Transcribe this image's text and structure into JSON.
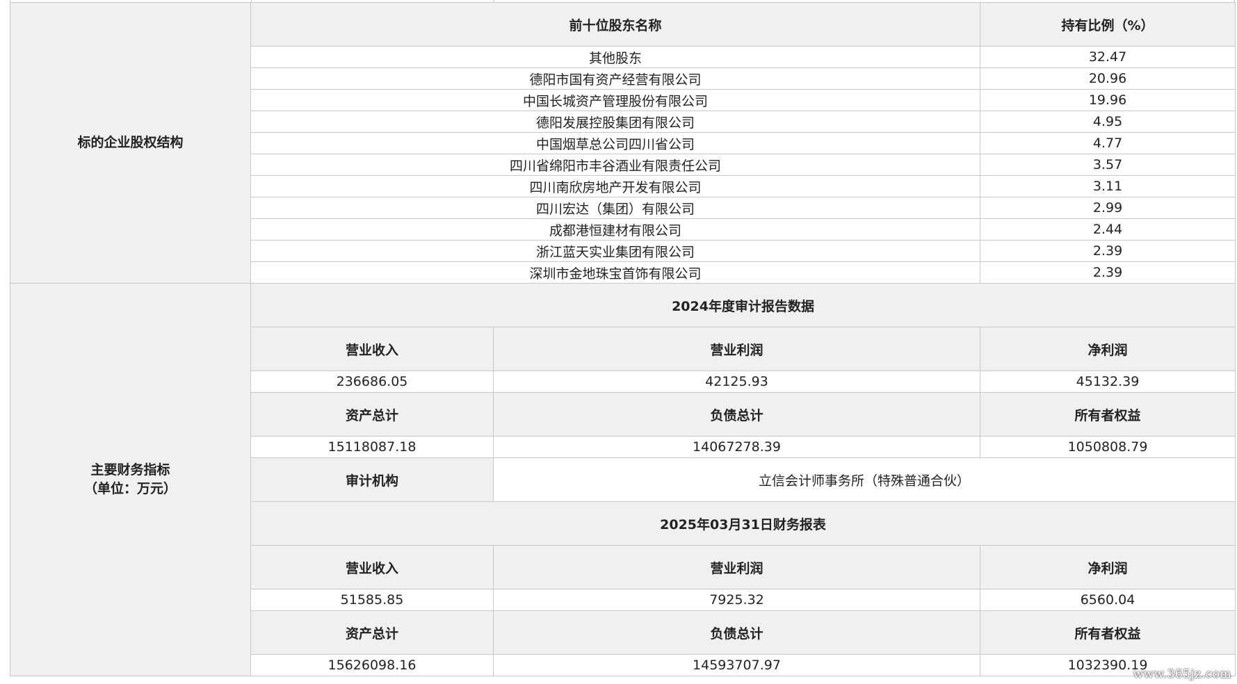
{
  "equity": {
    "section_label": "标的企业股权结构",
    "col_name_header": "前十位股东名称",
    "col_ratio_header": "持有比例（%）",
    "rows": [
      {
        "name": "其他股东",
        "ratio": "32.47"
      },
      {
        "name": "德阳市国有资产经营有限公司",
        "ratio": "20.96"
      },
      {
        "name": "中国长城资产管理股份有限公司",
        "ratio": "19.96"
      },
      {
        "name": "德阳发展控股集团有限公司",
        "ratio": "4.95"
      },
      {
        "name": "中国烟草总公司四川省公司",
        "ratio": "4.77"
      },
      {
        "name": "四川省绵阳市丰谷酒业有限责任公司",
        "ratio": "3.57"
      },
      {
        "name": "四川南欣房地产开发有限公司",
        "ratio": "3.11"
      },
      {
        "name": "四川宏达（集团）有限公司",
        "ratio": "2.99"
      },
      {
        "name": "成都港恒建材有限公司",
        "ratio": "2.44"
      },
      {
        "name": "浙江蓝天实业集团有限公司",
        "ratio": "2.39"
      },
      {
        "name": "深圳市金地珠宝首饰有限公司",
        "ratio": "2.39"
      }
    ]
  },
  "finance": {
    "section_label_line1": "主要财务指标",
    "section_label_line2": "（单位：万元）",
    "audit_2024": {
      "title": "2024年度审计报告数据",
      "revenue_label": "营业收入",
      "op_profit_label": "营业利润",
      "net_profit_label": "净利润",
      "revenue": "236686.05",
      "op_profit": "42125.93",
      "net_profit": "45132.39",
      "assets_label": "资产总计",
      "liabilities_label": "负债总计",
      "equity_label": "所有者权益",
      "assets": "15118087.18",
      "liabilities": "14067278.39",
      "owners_equity": "1050808.79",
      "auditor_label": "审计机构",
      "auditor": "立信会计师事务所（特殊普通合伙）"
    },
    "report_2025": {
      "title": "2025年03月31日财务报表",
      "revenue_label": "营业收入",
      "op_profit_label": "营业利润",
      "net_profit_label": "净利润",
      "revenue": "51585.85",
      "op_profit": "7925.32",
      "net_profit": "6560.04",
      "assets_label": "资产总计",
      "liabilities_label": "负债总计",
      "equity_label": "所有者权益",
      "assets": "15626098.16",
      "liabilities": "14593707.97",
      "owners_equity": "1032390.19"
    }
  },
  "watermark": "www.365jz.com"
}
